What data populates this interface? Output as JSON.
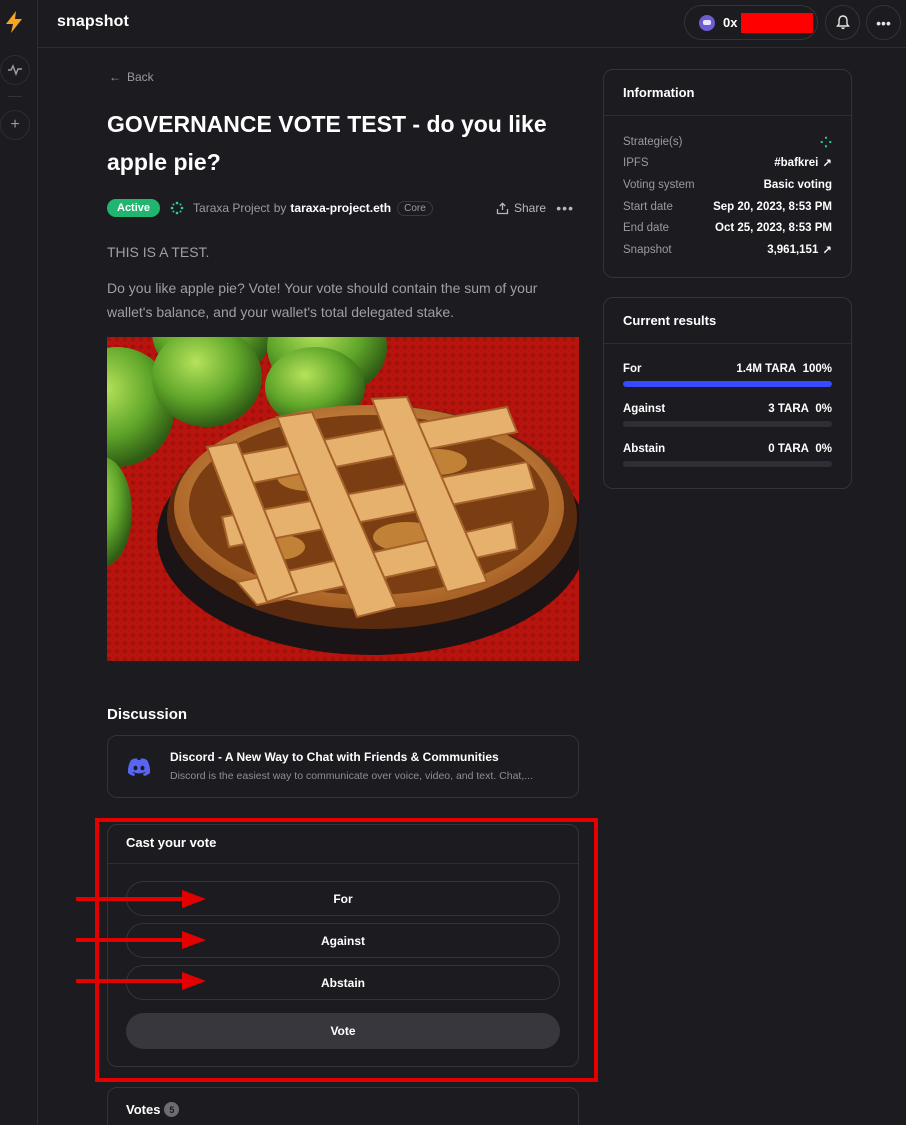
{
  "app": {
    "brand": "snapshot"
  },
  "header": {
    "account_prefix": "0x",
    "icons": [
      "bell-icon",
      "more-icon"
    ]
  },
  "nav": {
    "back_label": "Back"
  },
  "proposal": {
    "title": "GOVERNANCE VOTE TEST - do you like apple pie?",
    "status": "Active",
    "space": "Taraxa Project",
    "by_label": "by",
    "author": "taraxa-project.eth",
    "author_badge": "Core",
    "share_label": "Share",
    "body_line1": "THIS IS A TEST.",
    "body_line2": "Do you like apple pie? Vote! Your vote should contain the sum of your wallet's balance, and your wallet's total delegated stake."
  },
  "discussion": {
    "heading": "Discussion",
    "link_title": "Discord - A New Way to Chat with Friends & Communities",
    "link_desc": "Discord is the easiest way to communicate over voice, video, and text. Chat,..."
  },
  "vote_panel": {
    "title": "Cast your vote",
    "choices": [
      "For",
      "Against",
      "Abstain"
    ],
    "submit_label": "Vote"
  },
  "votes": {
    "title": "Votes",
    "count": "5"
  },
  "information": {
    "title": "Information",
    "rows": [
      {
        "label": "Strategie(s)",
        "value": ""
      },
      {
        "label": "IPFS",
        "value": "#bafkrei"
      },
      {
        "label": "Voting system",
        "value": "Basic voting"
      },
      {
        "label": "Start date",
        "value": "Sep 20, 2023, 8:53 PM"
      },
      {
        "label": "End date",
        "value": "Oct 25, 2023, 8:53 PM"
      },
      {
        "label": "Snapshot",
        "value": "3,961,151"
      }
    ]
  },
  "results": {
    "title": "Current results",
    "rows": [
      {
        "label": "For",
        "amount": "1.4M TARA",
        "percent": "100%",
        "fraction": 1.0
      },
      {
        "label": "Against",
        "amount": "3 TARA",
        "percent": "0%",
        "fraction": 0.0
      },
      {
        "label": "Abstain",
        "amount": "0 TARA",
        "percent": "0%",
        "fraction": 0.0
      }
    ]
  },
  "colors": {
    "accent": "#384aff",
    "active": "#21b66f",
    "annotation": "#e20000",
    "redaction": "#ff0000"
  }
}
